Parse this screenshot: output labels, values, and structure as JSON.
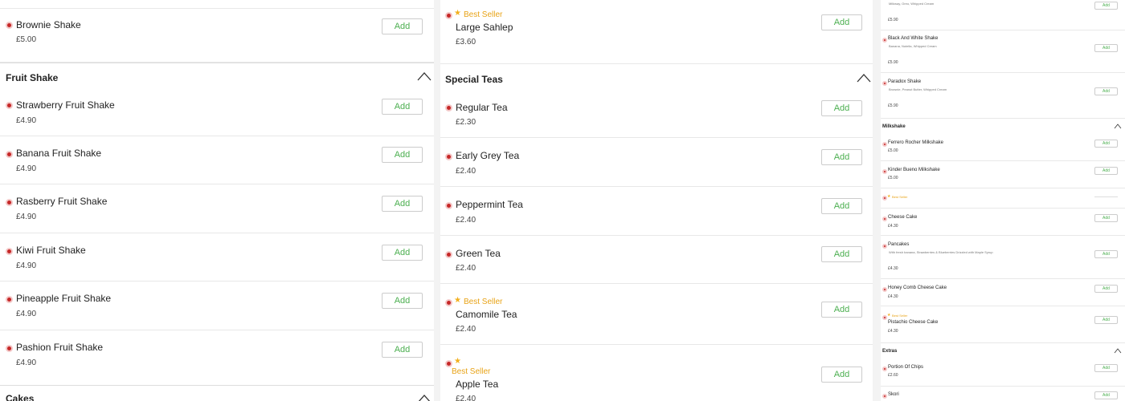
{
  "add_label": "Add",
  "best_seller_label": "Best Seller",
  "col1": {
    "top_item": {
      "name": "Brownie Shake",
      "price": "£5.00"
    },
    "fruit_shake": {
      "title": "Fruit Shake",
      "items": [
        {
          "name": "Strawberry Fruit Shake",
          "price": "£4.90"
        },
        {
          "name": "Banana Fruit Shake",
          "price": "£4.90"
        },
        {
          "name": "Rasberry Fruit Shake",
          "price": "£4.90"
        },
        {
          "name": "Kiwi Fruit Shake",
          "price": "£4.90"
        },
        {
          "name": "Pineapple Fruit Shake",
          "price": "£4.90"
        },
        {
          "name": "Pashion Fruit Shake",
          "price": "£4.90"
        }
      ]
    },
    "cakes": {
      "title": "Cakes"
    }
  },
  "col2": {
    "top_item": {
      "name": "Large Sahlep",
      "price": "£3.60"
    },
    "special_teas": {
      "title": "Special Teas",
      "items": [
        {
          "name": "Regular Tea",
          "price": "£2.30"
        },
        {
          "name": "Early Grey Tea",
          "price": "£2.40"
        },
        {
          "name": "Peppermint Tea",
          "price": "£2.40"
        },
        {
          "name": "Green Tea",
          "price": "£2.40"
        },
        {
          "name": "Camomile Tea",
          "price": "£2.40"
        },
        {
          "name": "Apple Tea",
          "price": "£2.40"
        }
      ]
    }
  },
  "col3": {
    "top_item": {
      "desc": "Milkway, Oreo, Whipped Cream",
      "price": "£5.90"
    },
    "items_a": [
      {
        "name": "Black And White Shake",
        "desc": "Banana, Nutella, Whipped Cream",
        "price": "£5.90"
      },
      {
        "name": "Paradox Shake",
        "desc": "Brownie, Peanut Butter, Whipped Cream",
        "price": "£5.90"
      }
    ],
    "milkshake": {
      "title": "Milkshake",
      "items": [
        {
          "name": "Ferrero Rocher Milkshake",
          "price": "£5.00"
        },
        {
          "name": "Kinder Bueno Milkshake",
          "price": "£5.00"
        }
      ]
    },
    "cakes_items": [
      {
        "name": "Cheese Cake",
        "price": "£4.30"
      },
      {
        "name": "Pancakes",
        "desc": "With fresh banana, Strawberries & Blueberries Drizzled with Maple Syrup",
        "price": "£4.30"
      },
      {
        "name": "Honey Comb Cheese Cake",
        "price": "£4.30"
      },
      {
        "name": "Pistachio Cheese Cake",
        "price": "£4.30"
      }
    ],
    "extras": {
      "title": "Extras",
      "items": [
        {
          "name": "Portion Of Chips",
          "price": "£2.60"
        },
        {
          "name": "Skori"
        }
      ]
    }
  },
  "colors": {
    "accent_red": "#c62828",
    "add_green": "#4caf50",
    "best_seller": "#e8a317"
  }
}
